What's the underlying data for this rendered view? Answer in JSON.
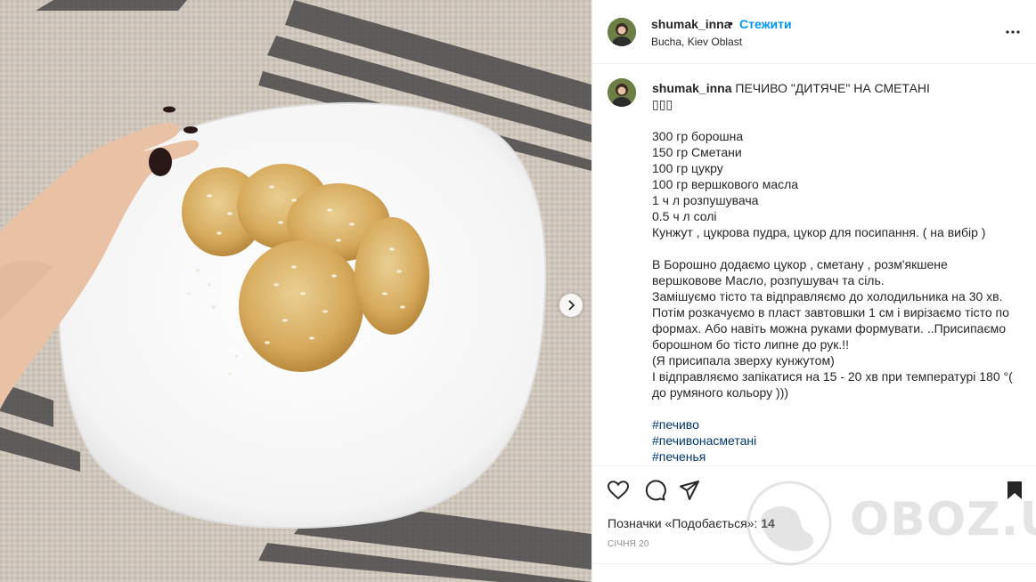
{
  "post": {
    "username": "shumak_inna",
    "separator": "•",
    "follow_label": "Стежити",
    "location": "Bucha, Kiev Oblast"
  },
  "caption": {
    "username": "shumak_inna",
    "title": "ПЕЧИВО \"ДИТЯЧЕ\" НА СМЕТАНІ",
    "emoji_line": "▯▯▯",
    "ingredients": [
      "300 гр борошна",
      "150 гр Сметани",
      "100 гр цукру",
      "100 гр вершкового масла",
      "1 ч л розпушувача",
      "0.5 ч л солі",
      "Кунжут , цукрова пудра, цукор для посипання. ( на вибір )"
    ],
    "instructions": [
      "В Борошно додаємо цукор , сметану , розм'якшене вершковове Масло, розпушувач та сіль.",
      "Замішуємо тісто та відправляємо до холодильника на 30 хв.",
      "Потім розкачуємо в пласт завтовшки 1 см і вирізаємо тісто по формах. Або навіть можна руками формувати. ..Присипаємо борошном бо тісто липне до рук.!!",
      "(Я присипала зверху кунжутом)",
      "І відправляємо запікатися на 15 - 20 хв при температурі 180 °( до румяного кольору )))"
    ],
    "hashtags": [
      "#печиво",
      "#печивонасметані",
      "#печенья"
    ]
  },
  "stats": {
    "likes_prefix": "Позначки «Подобається»: ",
    "likes_count": "14",
    "date": "СІЧНЯ 20"
  },
  "watermark": {
    "text": "OBOZ.UA"
  },
  "icons": {
    "like": "heart-icon",
    "comment": "comment-icon",
    "share": "share-icon",
    "save": "bookmark-icon",
    "more": "more-icon",
    "next": "chevron-right-icon"
  },
  "colors": {
    "follow": "#0095f6",
    "hashtag": "#00376b",
    "text": "#262626",
    "muted": "#8e8e8e"
  }
}
